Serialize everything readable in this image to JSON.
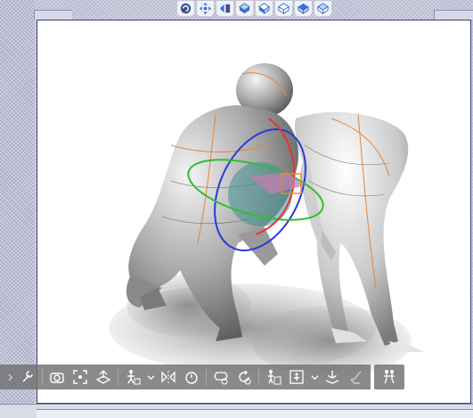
{
  "window": {
    "panel": "3d-pose-canvas",
    "accent_color": "#3b3f7a",
    "canvas_color": "#ffffff",
    "toolbar_color": "#707070"
  },
  "gizmo_toolbar": {
    "buttons": [
      {
        "icon": "camera-rotate-icon"
      },
      {
        "icon": "camera-pan-icon"
      },
      {
        "icon": "camera-dolly-icon"
      },
      {
        "icon": "move-x-icon"
      },
      {
        "icon": "move-y-icon"
      },
      {
        "icon": "move-z-icon"
      },
      {
        "icon": "rotate-x-icon"
      },
      {
        "icon": "rotate-y-icon"
      }
    ]
  },
  "object_launcher": {
    "buttons": [
      {
        "icon": "expand-arrow-icon"
      },
      {
        "icon": "wrench-icon"
      },
      {
        "icon": "camera-capture-icon"
      },
      {
        "icon": "fit-to-screen-icon"
      },
      {
        "icon": "ground-plane-icon"
      },
      {
        "icon": "pose-figure-icon"
      },
      {
        "icon": "dropdown-chevron-icon"
      },
      {
        "icon": "flip-pose-icon"
      },
      {
        "icon": "lock-joint-icon"
      },
      {
        "icon": "camera-reset-icon"
      },
      {
        "icon": "reset-rotation-icon"
      },
      {
        "icon": "fix-joint-icon"
      },
      {
        "icon": "body-shape-icon"
      },
      {
        "icon": "dropdown-chevron-icon"
      },
      {
        "icon": "ground-snap-icon"
      },
      {
        "icon": "hand-pose-icon"
      }
    ],
    "extra_button": {
      "icon": "multi-figure-icon"
    }
  },
  "scene": {
    "figures": [
      "figure-left-crouching",
      "figure-right-bending"
    ],
    "manipulator_colors": {
      "x": "#e23434",
      "y": "#2fbf2f",
      "z": "#2a3ad8",
      "selection": "#e88a2a"
    }
  }
}
